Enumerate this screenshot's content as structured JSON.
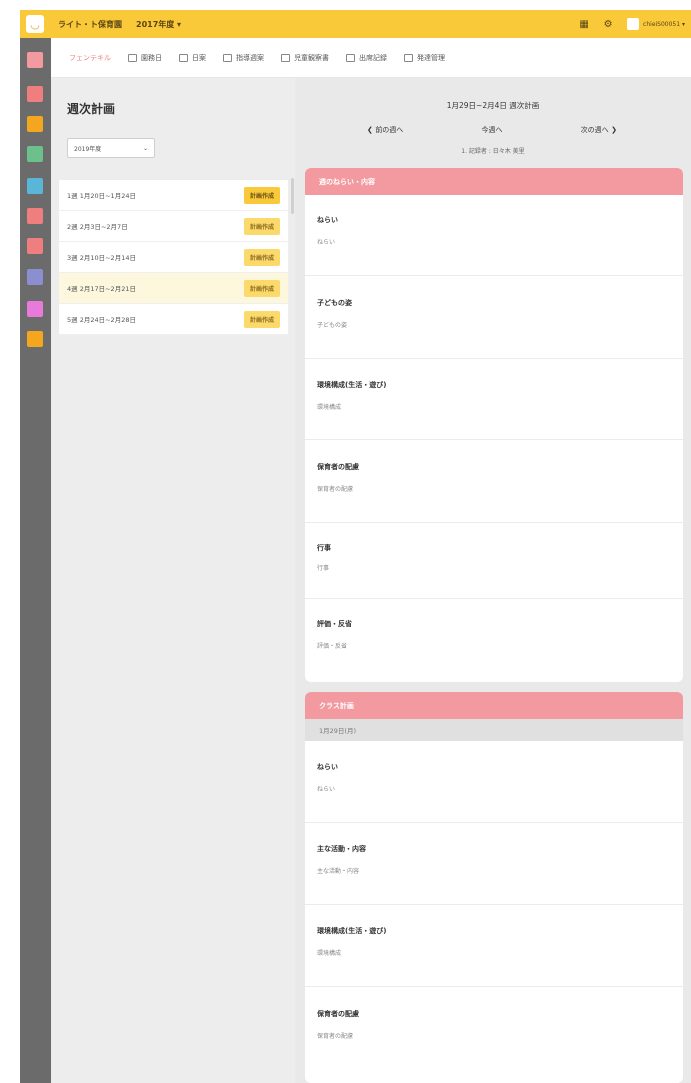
{
  "header": {
    "app_name": "ライト・ト保育園",
    "year_select": "2017年度 ▾",
    "user_name": "chieiS00051 ▾"
  },
  "tabs": [
    {
      "label": "フェンテキル",
      "active": true
    },
    {
      "label": "園務日",
      "active": false
    },
    {
      "label": "日案",
      "active": false
    },
    {
      "label": "指導週案",
      "active": false
    },
    {
      "label": "児童観察書",
      "active": false
    },
    {
      "label": "出席記録",
      "active": false
    },
    {
      "label": "発達管理",
      "active": false
    }
  ],
  "left_panel": {
    "title": "週次計画",
    "filter_value": "2019年度",
    "weeks": [
      {
        "label": "1週 1月20日~1月24日",
        "badge": "計画作成"
      },
      {
        "label": "2週 2月3日~2月7日",
        "badge": "計画作成"
      },
      {
        "label": "3週 2月10日~2月14日",
        "badge": "計画作成"
      },
      {
        "label": "4週 2月17日~2月21日",
        "badge": "計画作成"
      },
      {
        "label": "5週 2月24日~2月28日",
        "badge": "計画作成"
      }
    ]
  },
  "right_panel": {
    "title": "1月29日~2月4日 週次計画",
    "prev_label": "前の週へ",
    "current_label": "今週へ",
    "next_label": "次の週へ",
    "subtitle": "1. 記録者 : 日々木 美里",
    "section1": {
      "header": "週のねらい・内容",
      "fields": [
        {
          "label": "ねらい",
          "value": "ねらい"
        },
        {
          "label": "子どもの姿",
          "value": "子どもの姿"
        },
        {
          "label": "環境構成(生活・遊び)",
          "value": "環境構成"
        },
        {
          "label": "保育者の配慮",
          "value": "保育者の配慮"
        },
        {
          "label": "行事",
          "value": "行事"
        },
        {
          "label": "評価・反省",
          "value": "評価・反省"
        }
      ]
    },
    "section2": {
      "header": "クラス計画",
      "subheader": "1月29日(月)",
      "fields": [
        {
          "label": "ねらい",
          "value": "ねらい"
        },
        {
          "label": "主な活動・内容",
          "value": "主な活動・内容"
        },
        {
          "label": "環境構成(生活・遊び)",
          "value": "環境構成"
        },
        {
          "label": "保育者の配慮",
          "value": "保育者の配慮"
        }
      ]
    }
  },
  "colors": {
    "brand": "#f9c93a",
    "rail": "#6b6b6b",
    "accent": "#f39aa0",
    "rail_icons": [
      "#f39aa0",
      "#ef7f7f",
      "#f4a71e",
      "#6cc08b",
      "#5ab6d8",
      "#ef7f7f",
      "#ef7f7f",
      "#8b8fd0",
      "#e87ad9",
      "#f4a71e"
    ]
  }
}
